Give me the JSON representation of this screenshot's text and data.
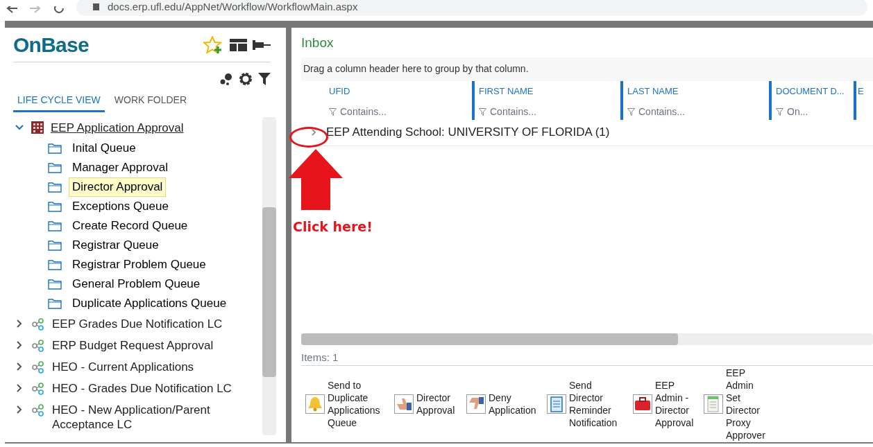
{
  "browser": {
    "url": "docs.erp.ufl.edu/AppNet/Workflow/WorkflowMain.aspx"
  },
  "sidebar": {
    "logo": "OnBase",
    "tabs": [
      {
        "label": "LIFE CYCLE VIEW",
        "selected": true
      },
      {
        "label": "WORK FOLDER",
        "selected": false
      }
    ],
    "tree": [
      {
        "label": "EEP Application Approval",
        "kind": "lifecycle-open",
        "expanded": true,
        "children": [
          {
            "label": "Inital Queue",
            "selected": false
          },
          {
            "label": "Manager Approval",
            "selected": false
          },
          {
            "label": "Director Approval",
            "selected": true
          },
          {
            "label": "Exceptions Queue",
            "selected": false
          },
          {
            "label": "Create Record Queue",
            "selected": false
          },
          {
            "label": "Registrar Queue",
            "selected": false
          },
          {
            "label": "Registrar Problem Queue",
            "selected": false
          },
          {
            "label": "General Problem Queue",
            "selected": false
          },
          {
            "label": "Duplicate Applications Queue",
            "selected": false
          }
        ]
      },
      {
        "label": "EEP Grades Due Notification LC",
        "kind": "lifecycle",
        "expanded": false
      },
      {
        "label": "ERP Budget Request Approval",
        "kind": "lifecycle",
        "expanded": false
      },
      {
        "label": "HEO - Current Applications",
        "kind": "lifecycle",
        "expanded": false
      },
      {
        "label": "HEO - Grades Due Notification LC",
        "kind": "lifecycle",
        "expanded": false
      },
      {
        "label": "HEO - New Application/Parent Acceptance LC",
        "kind": "lifecycle",
        "expanded": false
      }
    ]
  },
  "inbox": {
    "title": "Inbox",
    "group_hint": "Drag a column header here to group by that column.",
    "columns": [
      {
        "label": "UFID",
        "filter": "Contains..."
      },
      {
        "label": "FIRST NAME",
        "filter": "Contains..."
      },
      {
        "label": "LAST NAME",
        "filter": "Contains..."
      },
      {
        "label": "DOCUMENT D...",
        "filter": "On..."
      },
      {
        "label": "E"
      }
    ],
    "group_row": {
      "label": "EEP Attending School: UNIVERSITY OF FLORIDA (1)",
      "expanded": false
    },
    "items_count": "Items: 1",
    "actions": [
      {
        "label": "Send to Duplicate Applications Queue",
        "kind": "bell"
      },
      {
        "label": "Director Approval",
        "kind": "thumbs-up"
      },
      {
        "label": "Deny Application",
        "kind": "thumbs-down"
      },
      {
        "label": "Send Director Reminder Notification",
        "kind": "clipboard"
      },
      {
        "label": "EEP Admin - Director Approval",
        "kind": "toolbox"
      },
      {
        "label": "EEP Admin Set Director Proxy Approver",
        "kind": "notepad"
      }
    ]
  },
  "annotation": {
    "text": "Click here!"
  }
}
